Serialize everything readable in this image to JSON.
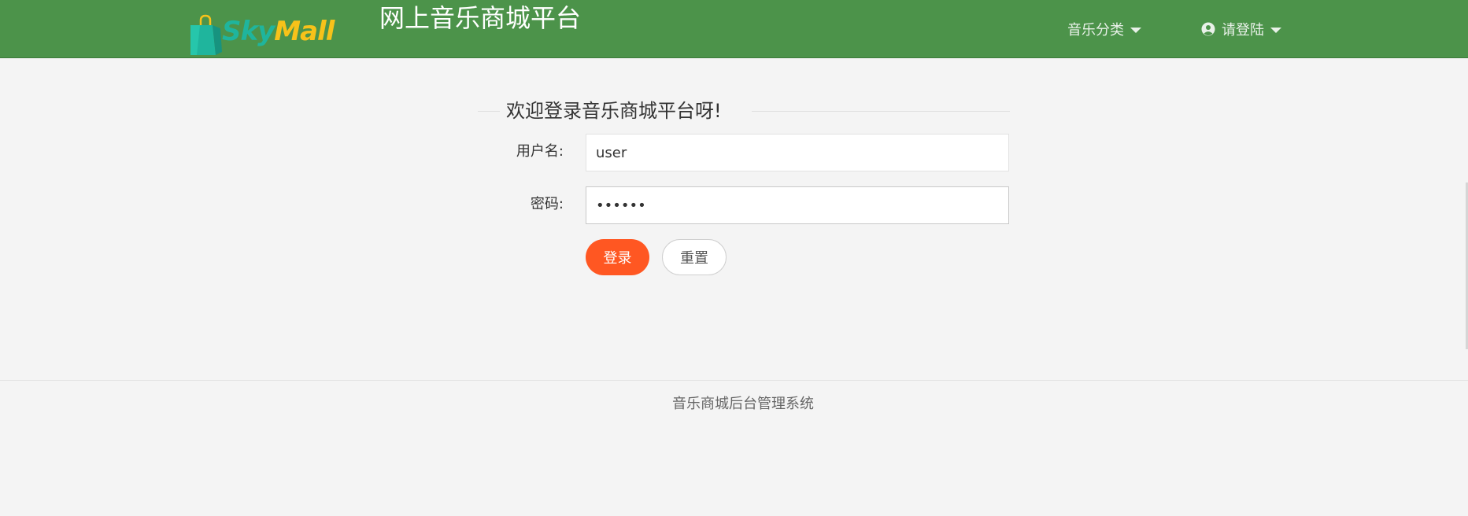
{
  "header": {
    "logo": {
      "text_part1": "Sky",
      "text_part2": "Mall",
      "colors": {
        "teal": "#1fb59d",
        "yellow": "#f7c21a"
      }
    },
    "title": "网上音乐商城平台",
    "nav": {
      "category_label": "音乐分类",
      "login_label": "请登陆"
    },
    "background": "#4c934a"
  },
  "login": {
    "legend": "欢迎登录音乐商城平台呀!",
    "username_label": "用户名:",
    "username_value": "user",
    "password_label": "密码:",
    "password_value": "123456",
    "login_button": "登录",
    "reset_button": "重置",
    "accent_color": "#ff5722"
  },
  "footer": {
    "text": "音乐商城后台管理系统"
  },
  "icons": {
    "logo": "shopping-bag-icon",
    "caret": "caret-down-icon",
    "user": "user-circle-icon"
  }
}
